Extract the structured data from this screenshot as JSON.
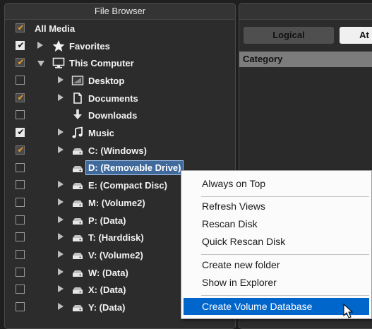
{
  "panel": {
    "title": "File Browser"
  },
  "tree": [
    {
      "label": "All Media",
      "check": "partial",
      "level": 0,
      "arrow": "none",
      "icon": "none",
      "selected": false
    },
    {
      "label": "Favorites",
      "check": "on",
      "level": 1,
      "arrow": "right",
      "icon": "star-icon",
      "selected": false
    },
    {
      "label": "This Computer",
      "check": "partial",
      "level": 1,
      "arrow": "down",
      "icon": "monitor-icon",
      "selected": false
    },
    {
      "label": "Desktop",
      "check": "off",
      "level": 2,
      "arrow": "right",
      "icon": "desktop-icon",
      "selected": false
    },
    {
      "label": "Documents",
      "check": "partial",
      "level": 2,
      "arrow": "right",
      "icon": "document-icon",
      "selected": false
    },
    {
      "label": "Downloads",
      "check": "off",
      "level": 2,
      "arrow": "none",
      "icon": "download-icon",
      "selected": false
    },
    {
      "label": "Music",
      "check": "on",
      "level": 2,
      "arrow": "right",
      "icon": "music-icon",
      "selected": false
    },
    {
      "label": "C: (Windows)",
      "check": "partial",
      "level": 2,
      "arrow": "right",
      "icon": "drive-icon",
      "selected": false
    },
    {
      "label": "D: (Removable Drive)",
      "check": "off",
      "level": 2,
      "arrow": "none",
      "icon": "drive-icon",
      "selected": true
    },
    {
      "label": "E: (Compact Disc)",
      "check": "off",
      "level": 2,
      "arrow": "right",
      "icon": "drive-icon",
      "selected": false
    },
    {
      "label": "M: (Volume2)",
      "check": "off",
      "level": 2,
      "arrow": "right",
      "icon": "drive-icon",
      "selected": false
    },
    {
      "label": "P: (Data)",
      "check": "off",
      "level": 2,
      "arrow": "right",
      "icon": "drive-icon",
      "selected": false
    },
    {
      "label": "T: (Harddisk)",
      "check": "off",
      "level": 2,
      "arrow": "right",
      "icon": "drive-icon",
      "selected": false
    },
    {
      "label": "V: (Volume2)",
      "check": "off",
      "level": 2,
      "arrow": "right",
      "icon": "drive-icon",
      "selected": false
    },
    {
      "label": "W: (Data)",
      "check": "off",
      "level": 2,
      "arrow": "right",
      "icon": "drive-icon",
      "selected": false
    },
    {
      "label": "X: (Data)",
      "check": "off",
      "level": 2,
      "arrow": "right",
      "icon": "drive-icon",
      "selected": false
    },
    {
      "label": "Y: (Data)",
      "check": "off",
      "level": 2,
      "arrow": "right",
      "icon": "drive-icon",
      "selected": false
    }
  ],
  "right": {
    "tab_logical": "Logical",
    "tab_attr": "At",
    "category_header": "Category"
  },
  "menu": {
    "items": [
      {
        "label": "Always on Top",
        "highlighted": false
      },
      {
        "label": "Refresh Views",
        "highlighted": false
      },
      {
        "label": "Rescan Disk",
        "highlighted": false
      },
      {
        "label": "Quick Rescan Disk",
        "highlighted": false
      },
      {
        "label": "Create new folder",
        "highlighted": false
      },
      {
        "label": "Show in Explorer",
        "highlighted": false
      },
      {
        "label": "Create Volume Database",
        "highlighted": true
      }
    ]
  },
  "colors": {
    "partial_check": "#e89a2a",
    "selection": "#3f6a9b",
    "menu_highlight": "#0066cc"
  }
}
